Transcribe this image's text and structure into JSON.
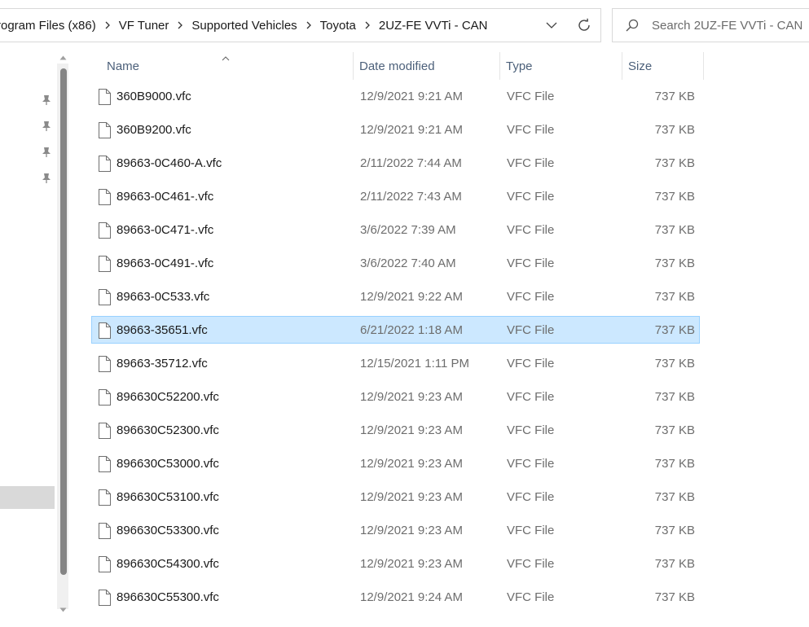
{
  "breadcrumb": [
    "rogram Files (x86)",
    "VF Tuner",
    "Supported Vehicles",
    "Toyota",
    "2UZ-FE VVTi - CAN"
  ],
  "address_icons": {
    "dropdown": "chevron-down-icon",
    "refresh": "refresh-icon"
  },
  "search": {
    "placeholder": "Search 2UZ-FE VVTi - CAN",
    "icon": "search-icon"
  },
  "columns": {
    "name": "Name",
    "date": "Date modified",
    "type": "Type",
    "size": "Size"
  },
  "selection_color": "#cce8ff",
  "files": [
    {
      "name": "360B9000.vfc",
      "date": "12/9/2021 9:21 AM",
      "type": "VFC File",
      "size": "737 KB",
      "selected": false
    },
    {
      "name": "360B9200.vfc",
      "date": "12/9/2021 9:21 AM",
      "type": "VFC File",
      "size": "737 KB",
      "selected": false
    },
    {
      "name": "89663-0C460-A.vfc",
      "date": "2/11/2022 7:44 AM",
      "type": "VFC File",
      "size": "737 KB",
      "selected": false
    },
    {
      "name": "89663-0C461-.vfc",
      "date": "2/11/2022 7:43 AM",
      "type": "VFC File",
      "size": "737 KB",
      "selected": false
    },
    {
      "name": "89663-0C471-.vfc",
      "date": "3/6/2022 7:39 AM",
      "type": "VFC File",
      "size": "737 KB",
      "selected": false
    },
    {
      "name": "89663-0C491-.vfc",
      "date": "3/6/2022 7:40 AM",
      "type": "VFC File",
      "size": "737 KB",
      "selected": false
    },
    {
      "name": "89663-0C533.vfc",
      "date": "12/9/2021 9:22 AM",
      "type": "VFC File",
      "size": "737 KB",
      "selected": false
    },
    {
      "name": "89663-35651.vfc",
      "date": "6/21/2022 1:18 AM",
      "type": "VFC File",
      "size": "737 KB",
      "selected": true
    },
    {
      "name": "89663-35712.vfc",
      "date": "12/15/2021 1:11 PM",
      "type": "VFC File",
      "size": "737 KB",
      "selected": false
    },
    {
      "name": "896630C52200.vfc",
      "date": "12/9/2021 9:23 AM",
      "type": "VFC File",
      "size": "737 KB",
      "selected": false
    },
    {
      "name": "896630C52300.vfc",
      "date": "12/9/2021 9:23 AM",
      "type": "VFC File",
      "size": "737 KB",
      "selected": false
    },
    {
      "name": "896630C53000.vfc",
      "date": "12/9/2021 9:23 AM",
      "type": "VFC File",
      "size": "737 KB",
      "selected": false
    },
    {
      "name": "896630C53100.vfc",
      "date": "12/9/2021 9:23 AM",
      "type": "VFC File",
      "size": "737 KB",
      "selected": false
    },
    {
      "name": "896630C53300.vfc",
      "date": "12/9/2021 9:23 AM",
      "type": "VFC File",
      "size": "737 KB",
      "selected": false
    },
    {
      "name": "896630C54300.vfc",
      "date": "12/9/2021 9:23 AM",
      "type": "VFC File",
      "size": "737 KB",
      "selected": false
    },
    {
      "name": "896630C55300.vfc",
      "date": "12/9/2021 9:24 AM",
      "type": "VFC File",
      "size": "737 KB",
      "selected": false
    }
  ]
}
